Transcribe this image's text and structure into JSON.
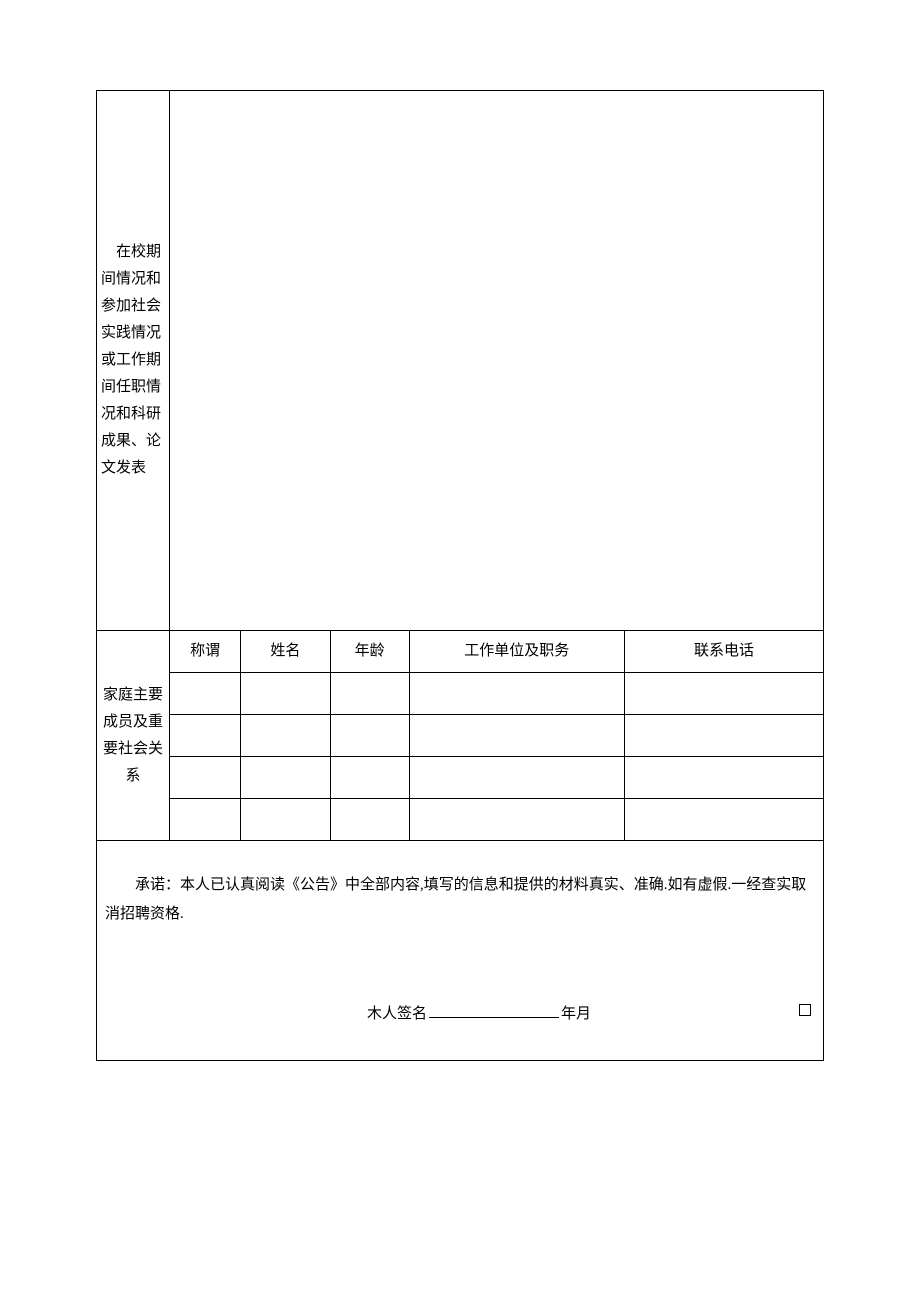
{
  "section1": {
    "label": "在校期间情况和参加社会实践情况或工作期间任职情况和科研成果、论文发表"
  },
  "family": {
    "label": "家庭主要成员及重要社会关系",
    "headers": {
      "relation": "称谓",
      "name": "姓名",
      "age": "年龄",
      "workunit": "工作单位及职务",
      "phone": "联系电话"
    },
    "rows": [
      {
        "relation": "",
        "name": "",
        "age": "",
        "workunit": "",
        "phone": ""
      },
      {
        "relation": "",
        "name": "",
        "age": "",
        "workunit": "",
        "phone": ""
      },
      {
        "relation": "",
        "name": "",
        "age": "",
        "workunit": "",
        "phone": ""
      },
      {
        "relation": "",
        "name": "",
        "age": "",
        "workunit": "",
        "phone": ""
      }
    ]
  },
  "commitment": {
    "text": "承诺：本人已认真阅读《公告》中全部内容,填写的信息和提供的材料真实、准确.如有虚假.一经查实取消招聘资格.",
    "signature_label": "木人签名",
    "date_suffix": "年月"
  }
}
